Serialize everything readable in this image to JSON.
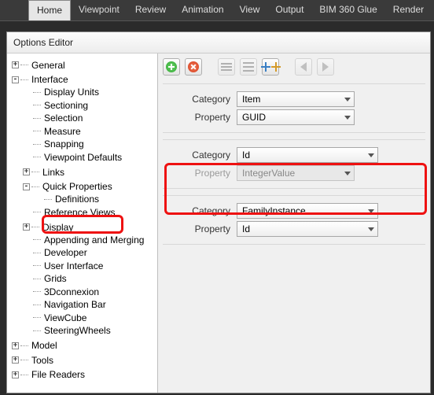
{
  "ribbon": {
    "tabs": [
      "Home",
      "Viewpoint",
      "Review",
      "Animation",
      "View",
      "Output",
      "BIM 360 Glue",
      "Render"
    ],
    "active_index": 0
  },
  "window": {
    "title": "Options Editor"
  },
  "tree": {
    "n_general": "General",
    "n_interface": "Interface",
    "n_display_units": "Display Units",
    "n_sectioning": "Sectioning",
    "n_selection": "Selection",
    "n_measure": "Measure",
    "n_snapping": "Snapping",
    "n_viewpoint_defaults": "Viewpoint Defaults",
    "n_links": "Links",
    "n_quick_properties": "Quick Properties",
    "n_definitions": "Definitions",
    "n_reference_views": "Reference Views",
    "n_display": "Display",
    "n_appending": "Appending and Merging",
    "n_developer": "Developer",
    "n_user_interface": "User Interface",
    "n_grids": "Grids",
    "n_3dconnexion": "3Dconnexion",
    "n_navigation_bar": "Navigation Bar",
    "n_viewcube": "ViewCube",
    "n_steeringwheels": "SteeringWheels",
    "n_model": "Model",
    "n_tools": "Tools",
    "n_file_readers": "File Readers"
  },
  "labels": {
    "category": "Category",
    "property": "Property"
  },
  "groups": [
    {
      "category": "Item",
      "property": "GUID",
      "prop_disabled": false,
      "cat_wide": false
    },
    {
      "category": "Id",
      "property": "IntegerValue",
      "prop_disabled": true,
      "cat_wide": true
    },
    {
      "category": "FamilyInstance",
      "property": "Id",
      "prop_disabled": false,
      "cat_wide": true
    }
  ]
}
